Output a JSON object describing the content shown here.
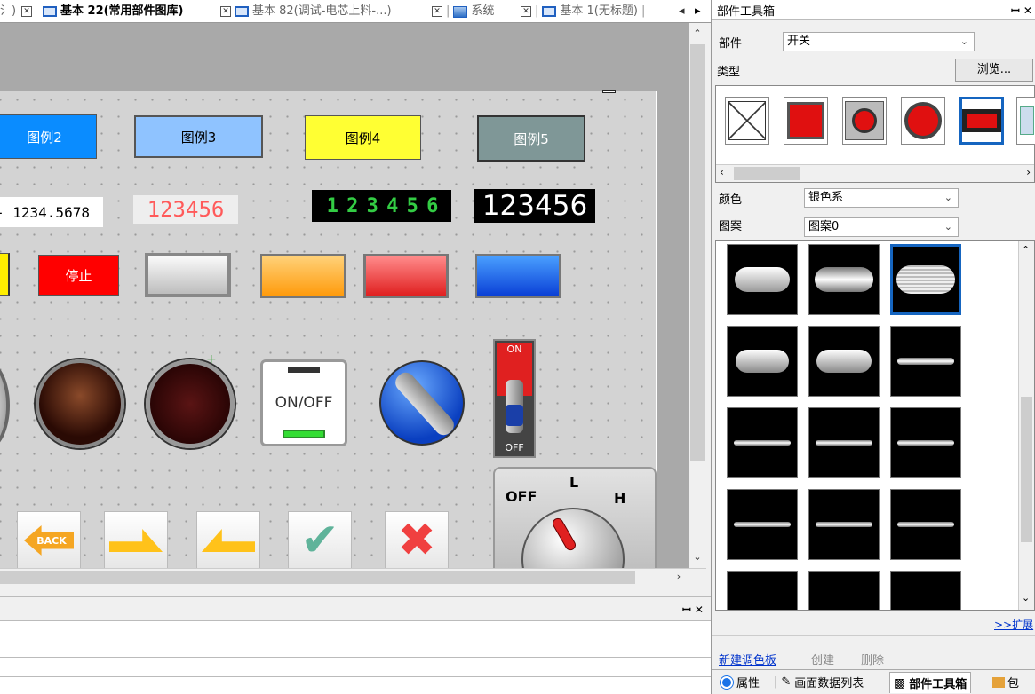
{
  "tabs": [
    {
      "label": "氵)",
      "active": false
    },
    {
      "label": "基本 22(常用部件图库)",
      "active": true
    },
    {
      "label": "基本 82(调试-电芯上料-...)",
      "active": false
    },
    {
      "label": "系统",
      "active": false
    },
    {
      "label": "基本 1(无标题)",
      "active": false
    }
  ],
  "canvas": {
    "buttons_row": [
      "图例2",
      "图例3",
      "图例4",
      "图例5"
    ],
    "num_display_1": "- 1234.5678",
    "num_display_2": "123456",
    "num_display_3": "1 2 3 4 5 6",
    "num_display_4": "123456",
    "stop_button": "停止",
    "onoff_label": "ON/OFF",
    "toggle_on": "ON",
    "toggle_off": "OFF",
    "selector_off": "OFF",
    "selector_l": "L",
    "selector_h": "H",
    "back_label": "BACK"
  },
  "right_panel": {
    "title": "部件工具箱",
    "pin": "ꟷ ✕",
    "part_label": "部件",
    "part_value": "开关",
    "type_label": "类型",
    "browse_button": "浏览...",
    "color_label": "颜色",
    "color_value": "银色系",
    "pattern_label": "图案",
    "pattern_value": "图案0",
    "expand_link": ">>扩展",
    "new_palette": "新建调色板",
    "create": "创建",
    "delete": "删除",
    "bottom_tabs": [
      "属性",
      "画面数据列表",
      "部件工具箱",
      "包"
    ]
  },
  "output_panel": {
    "pin": "ꟷ ✕"
  },
  "colors": {
    "accent": "#1565c0",
    "canvas_bg": "#d3d3d3"
  }
}
